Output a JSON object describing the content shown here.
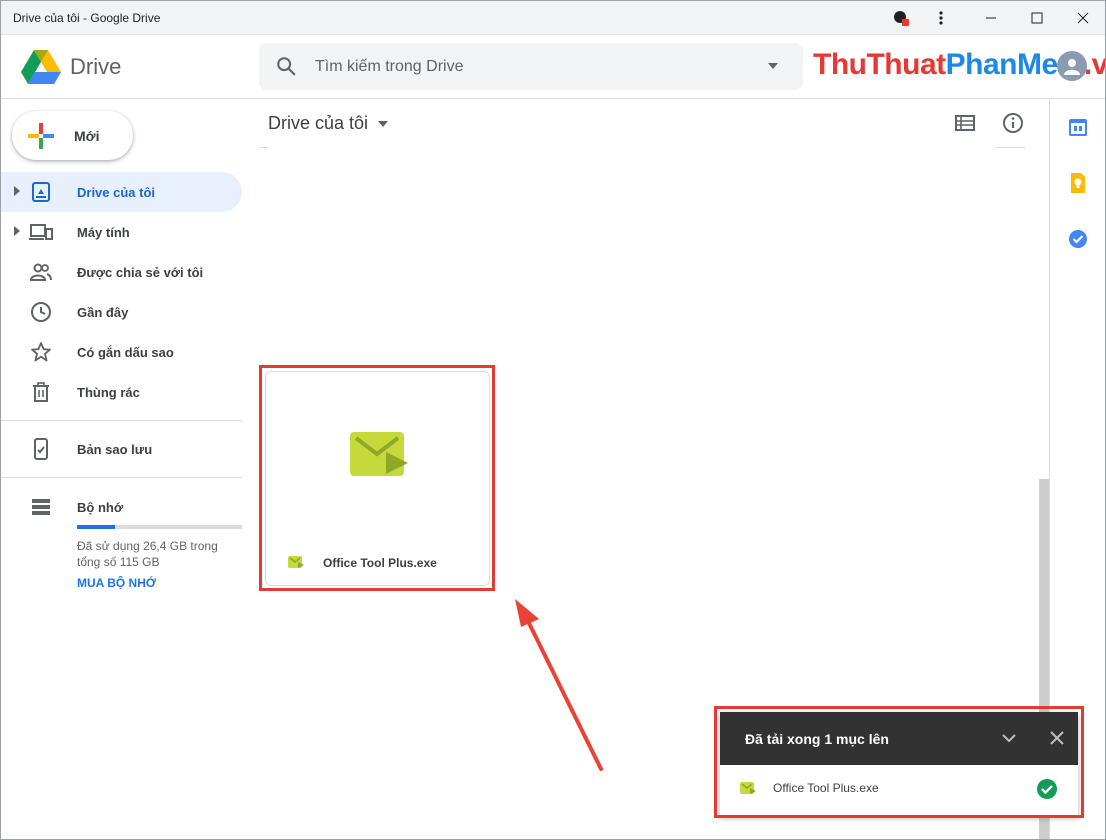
{
  "window": {
    "title": "Drive của tôi - Google Drive"
  },
  "header": {
    "brand": "Drive",
    "search_placeholder": "Tìm kiếm trong Drive",
    "watermark_part1": "ThuThuat",
    "watermark_part2": "PhanMem",
    "watermark_part3": ".vn"
  },
  "sidebar": {
    "new_label": "Mới",
    "items": [
      {
        "label": "Drive của tôi"
      },
      {
        "label": "Máy tính"
      },
      {
        "label": "Được chia sẻ với tôi"
      },
      {
        "label": "Gần đây"
      },
      {
        "label": "Có gắn dấu sao"
      },
      {
        "label": "Thùng rác"
      },
      {
        "label": "Bản sao lưu"
      },
      {
        "label": "Bộ nhớ"
      }
    ],
    "storage": {
      "used_fraction": 0.23,
      "text": "Đã sử dụng 26,4 GB trong tổng số 115 GB",
      "buy_label": "MUA BỘ NHỚ"
    }
  },
  "main": {
    "title": "Drive của tôi",
    "file": {
      "name": "Office Tool Plus.exe"
    }
  },
  "upload": {
    "title": "Đã tải xong 1 mục lên",
    "file_name": "Office Tool Plus.exe"
  },
  "colors": {
    "accent": "#1a73e8",
    "highlight": "#e53935",
    "file_green": "#c5d93a"
  }
}
